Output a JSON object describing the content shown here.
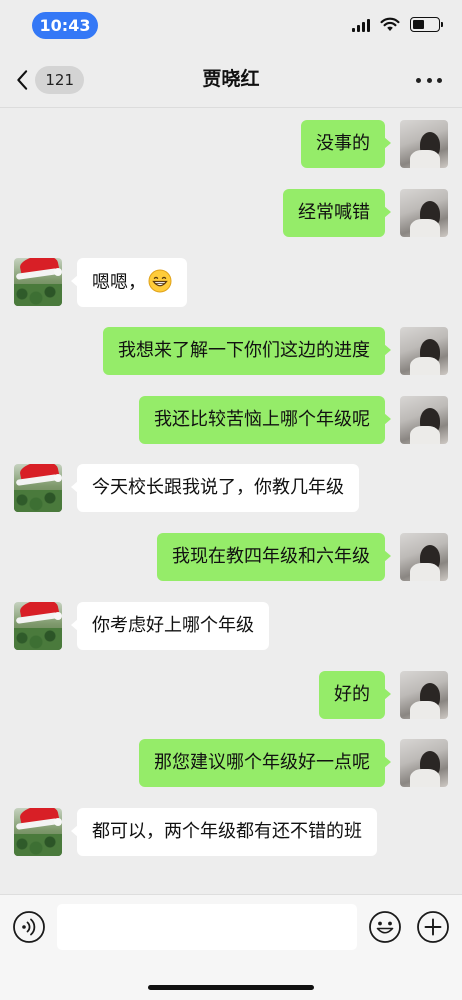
{
  "status_bar": {
    "time": "10:43"
  },
  "nav": {
    "back_count": "121",
    "title": "贾晓红"
  },
  "messages": [
    {
      "side": "me",
      "text": "没事的"
    },
    {
      "side": "me",
      "text": "经常喊错"
    },
    {
      "side": "them",
      "text": "嗯嗯，",
      "emoji": "grinning-face-icon"
    },
    {
      "side": "me",
      "text": "我想来了解一下你们这边的进度"
    },
    {
      "side": "me",
      "text": "我还比较苦恼上哪个年级呢"
    },
    {
      "side": "them",
      "text": "今天校长跟我说了，你教几年级"
    },
    {
      "side": "me",
      "text": "我现在教四年级和六年级"
    },
    {
      "side": "them",
      "text": "你考虑好上哪个年级"
    },
    {
      "side": "me",
      "text": "好的"
    },
    {
      "side": "me",
      "text": "那您建议哪个年级好一点呢"
    },
    {
      "side": "them",
      "text": "都可以，两个年级都有还不错的班"
    }
  ],
  "input": {
    "value": "",
    "placeholder": ""
  },
  "colors": {
    "me_bubble": "#95ec69",
    "them_bubble": "#ffffff",
    "background": "#ededed",
    "time_pill": "#3478f6"
  }
}
